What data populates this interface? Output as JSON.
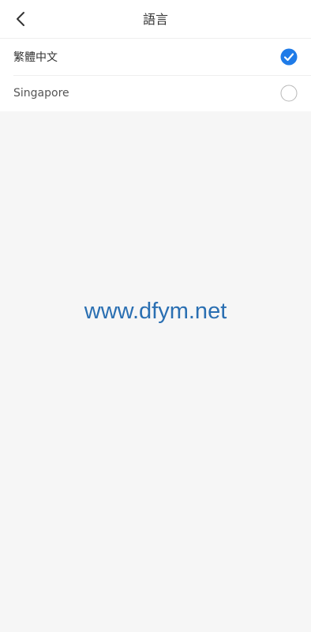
{
  "header": {
    "title": "語言",
    "back_icon": "chevron-left-icon"
  },
  "languages": [
    {
      "label": "繁體中文",
      "selected": true
    },
    {
      "label": "Singapore",
      "selected": false
    }
  ],
  "watermark": "www.dfym.net",
  "colors": {
    "accent": "#1f7be8",
    "watermark": "#2a6fb2",
    "background": "#f6f6f6"
  }
}
